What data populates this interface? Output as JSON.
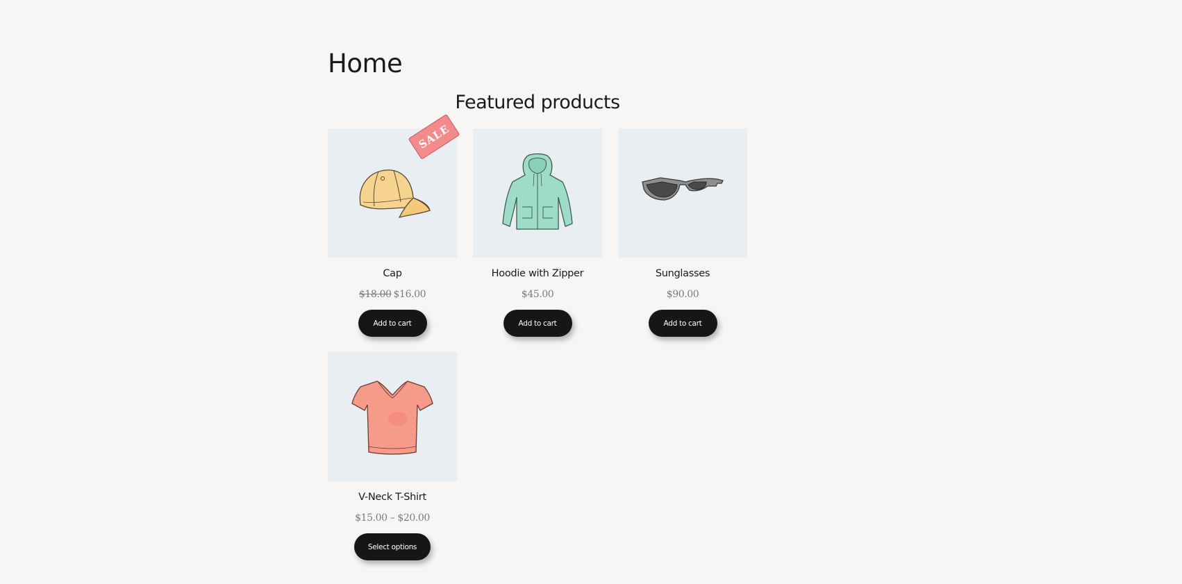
{
  "page": {
    "title": "Home"
  },
  "featured": {
    "heading": "Featured products",
    "products": [
      {
        "name": "Cap",
        "old_price": "$18.00",
        "price": "$16.00",
        "badge": "SALE",
        "button": "Add to cart",
        "image_icon": "cap-icon"
      },
      {
        "name": "Hoodie with Zipper",
        "price": "$45.00",
        "button": "Add to cart",
        "image_icon": "hoodie-icon"
      },
      {
        "name": "Sunglasses",
        "price": "$90.00",
        "button": "Add to cart",
        "image_icon": "sunglasses-icon"
      },
      {
        "name": "V-Neck T-Shirt",
        "price": "$15.00 – $20.00",
        "button": "Select options",
        "image_icon": "tshirt-icon"
      }
    ]
  },
  "colors": {
    "background": "#f8f6f4",
    "thumb_background": "#e9eef3",
    "button": "#161616",
    "sale_badge": "#f38a8c"
  }
}
